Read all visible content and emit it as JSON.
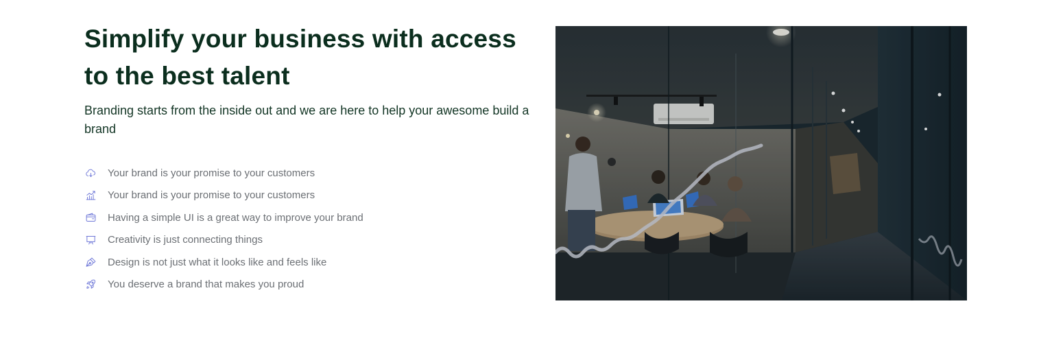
{
  "hero": {
    "title": "Simplify your business with access to the best talent",
    "subtitle": "Branding starts from the inside out and we are here to help your awesome build a brand"
  },
  "features": [
    {
      "icon": "cloud-icon",
      "label": "Your brand is your promise to your customers"
    },
    {
      "icon": "bar-chart-icon",
      "label": "Your brand is your promise to your customers"
    },
    {
      "icon": "wallet-icon",
      "label": "Having a simple UI is a great way to improve your brand"
    },
    {
      "icon": "display-icon",
      "label": "Creativity is just connecting things"
    },
    {
      "icon": "pen-tool-icon",
      "label": "Design is not just what it looks like and feels like"
    },
    {
      "icon": "rocket-icon",
      "label": "You deserve a brand that makes you proud"
    }
  ],
  "colors": {
    "heading": "#0b2e1e",
    "body_text": "#6b6f74",
    "icon_accent": "#6f78d8"
  }
}
